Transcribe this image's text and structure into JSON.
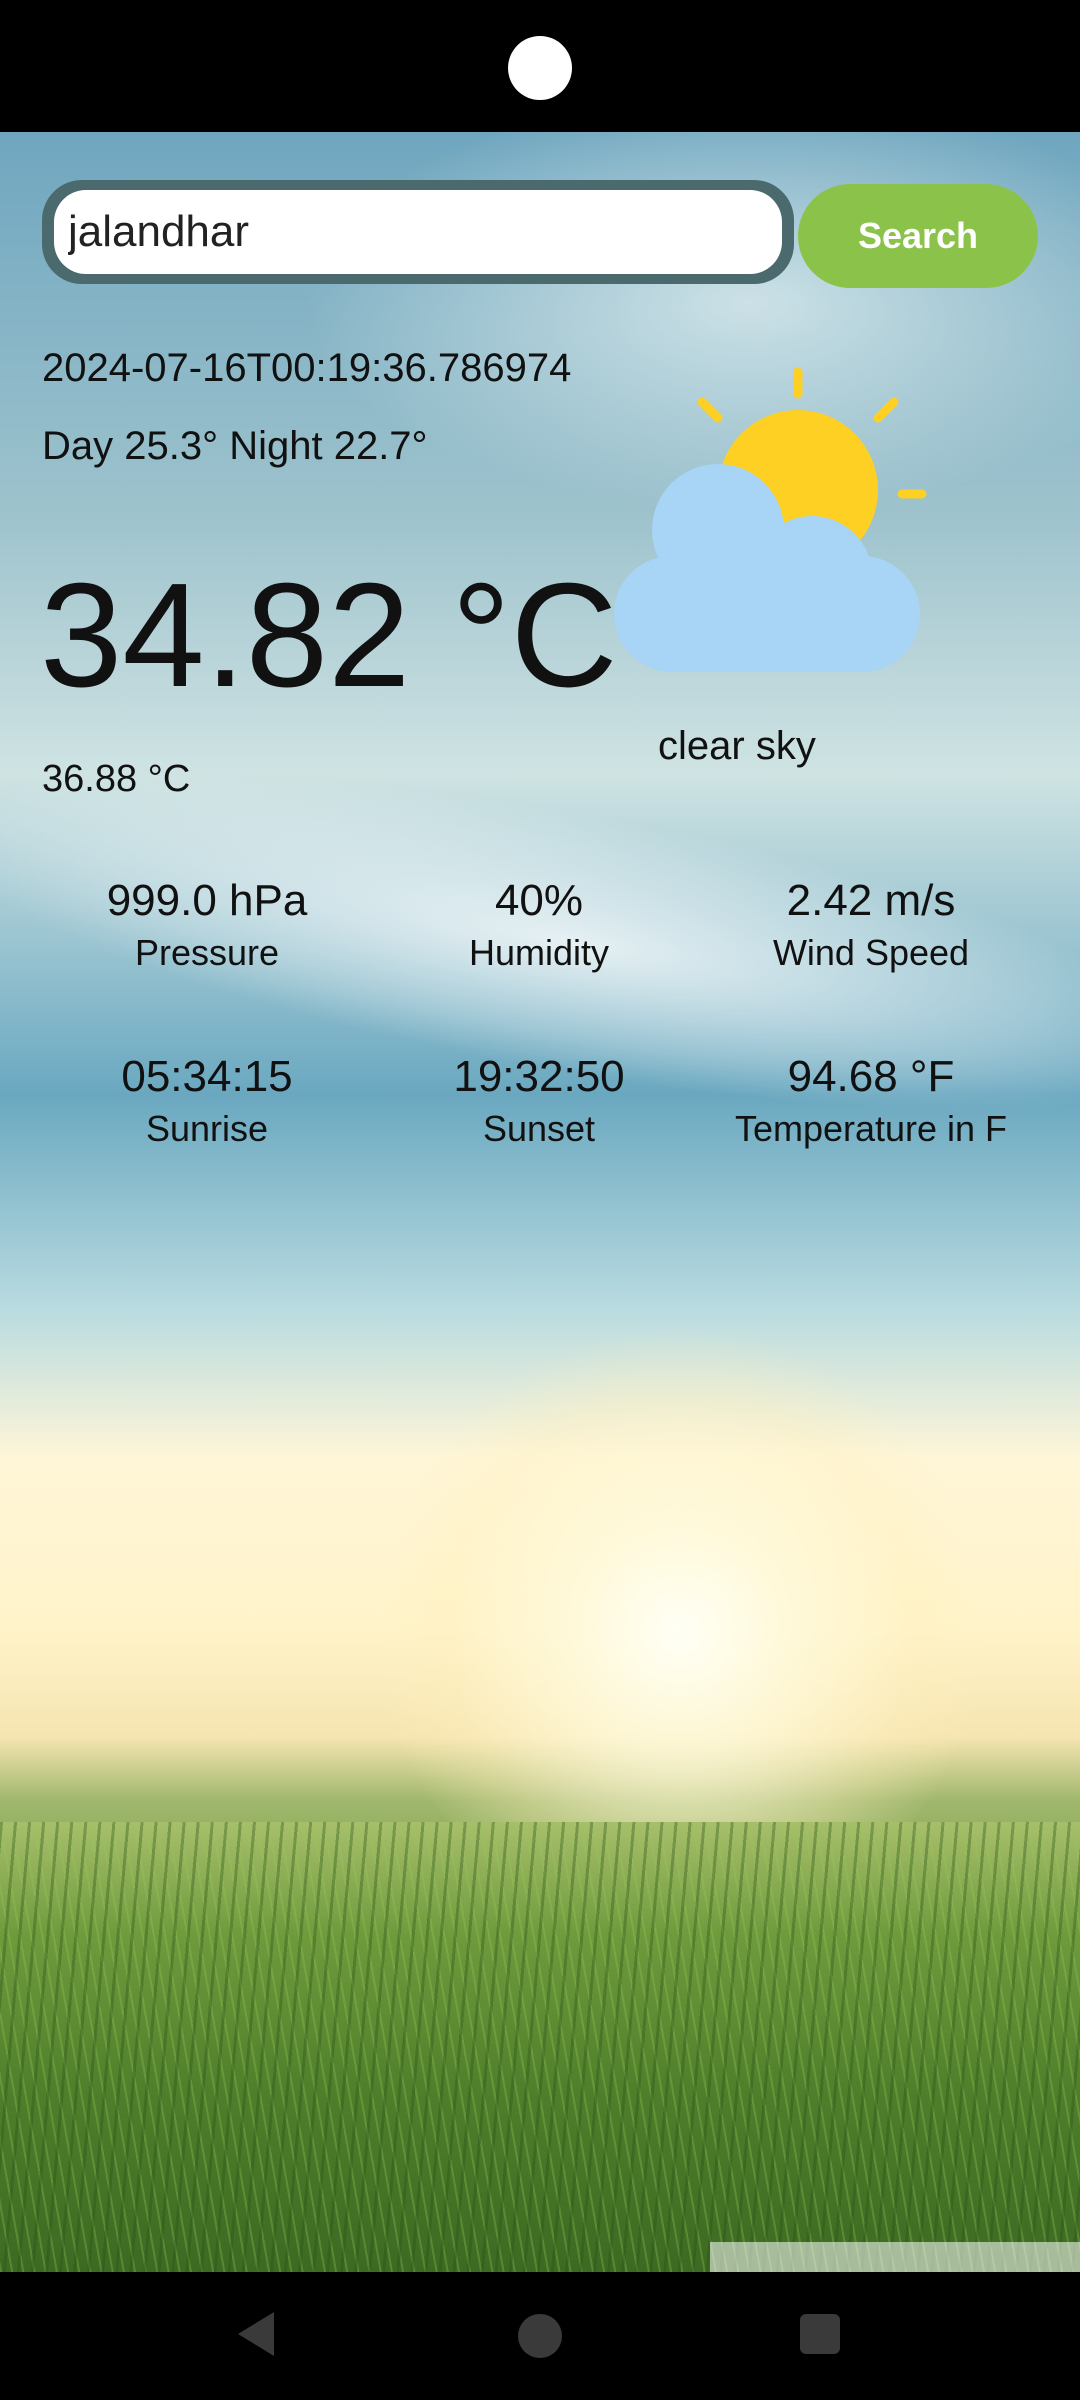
{
  "search": {
    "value": "jalandhar",
    "button_label": "Search"
  },
  "weather": {
    "datetime": "2024-07-16T00:19:36.786974",
    "day_night": "Day 25.3° Night 22.7°",
    "temperature": "34.82 °C",
    "feels_like": "36.88 °C",
    "condition": "clear sky",
    "icon": "partly-cloudy-icon"
  },
  "stats": [
    {
      "value": "999.0 hPa",
      "label": "Pressure"
    },
    {
      "value": "40%",
      "label": "Humidity"
    },
    {
      "value": "2.42 m/s",
      "label": "Wind Speed"
    },
    {
      "value": "05:34:15",
      "label": "Sunrise"
    },
    {
      "value": "19:32:50",
      "label": "Sunset"
    },
    {
      "value": "94.68 °F",
      "label": "Temperature in F"
    }
  ],
  "colors": {
    "search_button": "#8bc34a",
    "sun": "#fdd023",
    "cloud": "#a8d4f5"
  }
}
